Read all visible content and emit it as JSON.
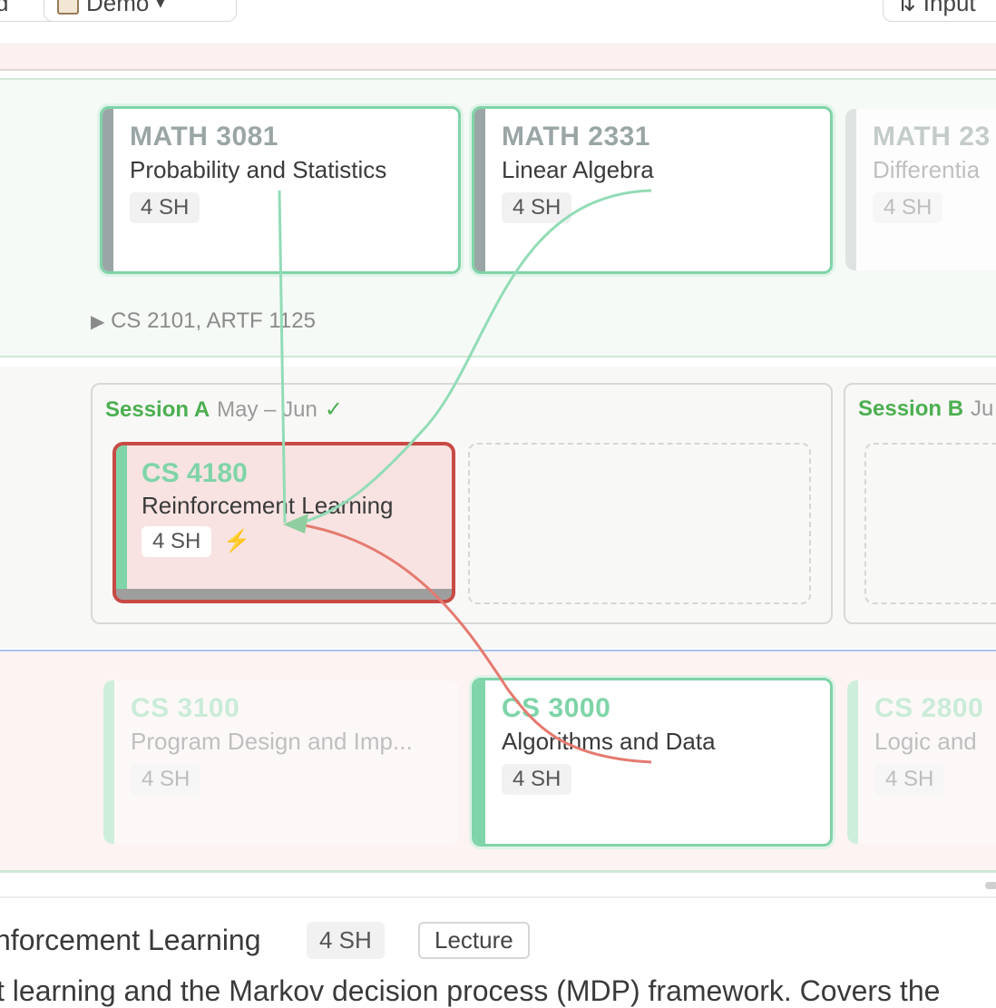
{
  "toolbar": {
    "left_btn_label": "d",
    "demo_label": "Demo",
    "right_btn_label": "Input"
  },
  "year_section": {
    "courses": [
      {
        "code": "MATH 3081",
        "title": "Probability and Statistics",
        "sh": "4 SH"
      },
      {
        "code": "MATH 2331",
        "title": "Linear Algebra",
        "sh": "4 SH"
      },
      {
        "code": "MATH 23",
        "title": "Differentia",
        "sh": "4 SH"
      }
    ],
    "prereq_toggle": "CS 2101, ARTF 1125"
  },
  "sessions": [
    {
      "name": "Session A",
      "dates": "May – Jun",
      "check": "✓"
    },
    {
      "name": "Session B",
      "dates": "Ju"
    }
  ],
  "selected_course": {
    "code": "CS 4180",
    "title": "Reinforcement Learning",
    "sh": "4 SH",
    "bolt": "⚡"
  },
  "lower_section": {
    "courses": [
      {
        "code": "CS 3100",
        "title": "Program Design and Imp...",
        "sh": "4 SH"
      },
      {
        "code": "CS 3000",
        "title": "Algorithms and Data",
        "sh": "4 SH"
      },
      {
        "code": "CS 2800",
        "title": "Logic and",
        "sh": "4 SH"
      }
    ]
  },
  "detail": {
    "title": "nforcement Learning",
    "sh": "4 SH",
    "type": "Lecture",
    "description": "t learning and the Markov decision process (MDP) framework. Covers the"
  },
  "colors": {
    "accent_green": "#7fd4a8",
    "session_green": "#4caf50",
    "selected_border": "#c84a45",
    "arrow_red": "#e57a70"
  }
}
